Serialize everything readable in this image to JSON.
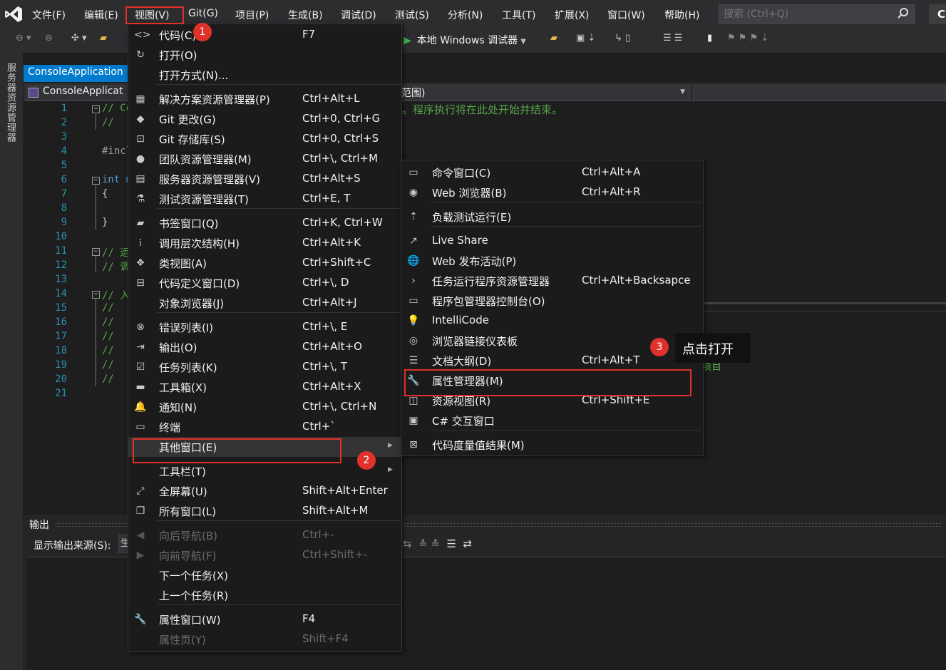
{
  "menubar": {
    "items": [
      "文件(F)",
      "编辑(E)",
      "视图(V)",
      "Git(G)",
      "项目(P)",
      "生成(B)",
      "调试(D)",
      "测试(S)",
      "分析(N)",
      "工具(T)",
      "扩展(X)",
      "窗口(W)",
      "帮助(H)"
    ],
    "search_placeholder": "搜索 (Ctrl+Q)",
    "account_initial": "C"
  },
  "toolbar": {
    "debug_target": "本地 Windows 调试器"
  },
  "side_tab": "服务器资源管理器",
  "document_tab": "ConsoleApplication",
  "navbar": {
    "file_combo": "ConsoleApplicat",
    "scope_combo": "范围)"
  },
  "editor": {
    "line_numbers": [
      "1",
      "2",
      "3",
      "4",
      "5",
      "6",
      "7",
      "8",
      "9",
      "10",
      "11",
      "12",
      "13",
      "14",
      "15",
      "16",
      "17",
      "18",
      "19",
      "20",
      "21"
    ],
    "fragments": {
      "l1": "// Co",
      "l2": "//",
      "l4": "#incl",
      "l6": "int m",
      "l7": "{",
      "l9": "}",
      "l11": "// 运",
      "l12": "// 调",
      "l14": "// 入",
      "l15": "//",
      "l16": "//",
      "l17": "//",
      "l18": "//",
      "l19": "//",
      "l20": "//"
    },
    "comment_tail": "。程序执行将在此处开始并结束。",
    "project_text": "项目"
  },
  "output": {
    "title": "输出",
    "source_label": "显示输出来源(S):",
    "source_value": "生"
  },
  "view_menu": [
    {
      "icon": "code-icon",
      "label": "代码(C)",
      "shortcut": "F7"
    },
    {
      "icon": "open-icon",
      "label": "打开(O)",
      "shortcut": ""
    },
    {
      "icon": "",
      "label": "打开方式(N)...",
      "shortcut": ""
    },
    {
      "icon": "solution-explorer-icon",
      "label": "解决方案资源管理器(P)",
      "shortcut": "Ctrl+Alt+L"
    },
    {
      "icon": "git-changes-icon",
      "label": "Git 更改(G)",
      "shortcut": "Ctrl+0, Ctrl+G"
    },
    {
      "icon": "git-repo-icon",
      "label": "Git 存储库(S)",
      "shortcut": "Ctrl+0, Ctrl+S"
    },
    {
      "icon": "team-explorer-icon",
      "label": "团队资源管理器(M)",
      "shortcut": "Ctrl+\\, Ctrl+M"
    },
    {
      "icon": "server-explorer-icon",
      "label": "服务器资源管理器(V)",
      "shortcut": "Ctrl+Alt+S"
    },
    {
      "icon": "test-explorer-icon",
      "label": "测试资源管理器(T)",
      "shortcut": "Ctrl+E, T"
    },
    {
      "icon": "bookmark-icon",
      "label": "书签窗口(Q)",
      "shortcut": "Ctrl+K, Ctrl+W"
    },
    {
      "icon": "call-hierarchy-icon",
      "label": "调用层次结构(H)",
      "shortcut": "Ctrl+Alt+K"
    },
    {
      "icon": "class-view-icon",
      "label": "类视图(A)",
      "shortcut": "Ctrl+Shift+C"
    },
    {
      "icon": "code-definition-icon",
      "label": "代码定义窗口(D)",
      "shortcut": "Ctrl+\\, D"
    },
    {
      "icon": "",
      "label": "对象浏览器(J)",
      "shortcut": "Ctrl+Alt+J"
    },
    {
      "icon": "error-list-icon",
      "label": "错误列表(I)",
      "shortcut": "Ctrl+\\, E"
    },
    {
      "icon": "output-icon",
      "label": "输出(O)",
      "shortcut": "Ctrl+Alt+O"
    },
    {
      "icon": "task-list-icon",
      "label": "任务列表(K)",
      "shortcut": "Ctrl+\\, T"
    },
    {
      "icon": "toolbox-icon",
      "label": "工具箱(X)",
      "shortcut": "Ctrl+Alt+X"
    },
    {
      "icon": "bell-icon",
      "label": "通知(N)",
      "shortcut": "Ctrl+\\, Ctrl+N"
    },
    {
      "icon": "terminal-icon",
      "label": "终端",
      "shortcut": "Ctrl+`"
    },
    {
      "icon": "",
      "label": "其他窗口(E)",
      "shortcut": ""
    },
    {
      "icon": "",
      "label": "工具栏(T)",
      "shortcut": ""
    },
    {
      "icon": "fullscreen-icon",
      "label": "全屏幕(U)",
      "shortcut": "Shift+Alt+Enter"
    },
    {
      "icon": "all-windows-icon",
      "label": "所有窗口(L)",
      "shortcut": "Shift+Alt+M"
    },
    {
      "icon": "back-icon",
      "label": "向后导航(B)",
      "shortcut": "Ctrl+-"
    },
    {
      "icon": "forward-icon",
      "label": "向前导航(F)",
      "shortcut": "Ctrl+Shift+-"
    },
    {
      "icon": "",
      "label": "下一个任务(X)",
      "shortcut": ""
    },
    {
      "icon": "",
      "label": "上一个任务(R)",
      "shortcut": ""
    },
    {
      "icon": "wrench-icon",
      "label": "属性窗口(W)",
      "shortcut": "F4"
    },
    {
      "icon": "",
      "label": "属性页(Y)",
      "shortcut": "Shift+F4"
    }
  ],
  "other_windows_menu": [
    {
      "icon": "command-window-icon",
      "label": "命令窗口(C)",
      "shortcut": "Ctrl+Alt+A"
    },
    {
      "icon": "web-browser-icon",
      "label": "Web 浏览器(B)",
      "shortcut": "Ctrl+Alt+R"
    },
    {
      "icon": "load-test-icon",
      "label": "负载测试运行(E)",
      "shortcut": ""
    },
    {
      "icon": "live-share-icon",
      "label": "Live Share",
      "shortcut": ""
    },
    {
      "icon": "web-publish-icon",
      "label": "Web 发布活动(P)",
      "shortcut": ""
    },
    {
      "icon": "task-runner-icon",
      "label": "任务运行程序资源管理器",
      "shortcut": "Ctrl+Alt+Backsapce"
    },
    {
      "icon": "package-console-icon",
      "label": "程序包管理器控制台(O)",
      "shortcut": ""
    },
    {
      "icon": "intellicode-icon",
      "label": "IntelliCode",
      "shortcut": ""
    },
    {
      "icon": "browser-link-icon",
      "label": "浏览器链接仪表板",
      "shortcut": ""
    },
    {
      "icon": "document-outline-icon",
      "label": "文档大纲(D)",
      "shortcut": "Ctrl+Alt+T"
    },
    {
      "icon": "wrench-icon",
      "label": "属性管理器(M)",
      "shortcut": ""
    },
    {
      "icon": "resource-view-icon",
      "label": "资源视图(R)",
      "shortcut": "Ctrl+Shift+E"
    },
    {
      "icon": "csharp-interactive-icon",
      "label": "C# 交互窗口",
      "shortcut": ""
    },
    {
      "icon": "code-metrics-icon",
      "label": "代码度量值结果(M)",
      "shortcut": ""
    }
  ],
  "annotations": {
    "badge1": "1",
    "badge2": "2",
    "badge3": "3",
    "tooltip": "点击打开",
    "highlight_color": "#e0312b"
  }
}
